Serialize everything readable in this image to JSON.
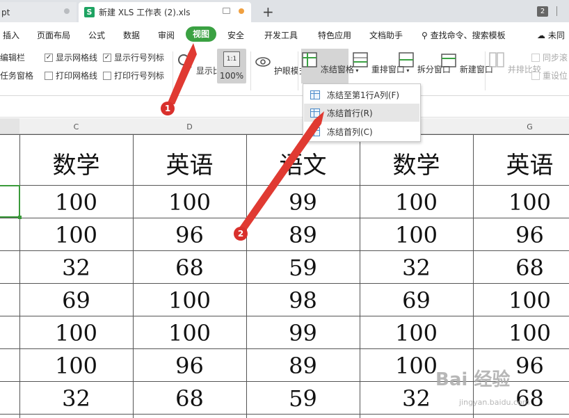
{
  "tabs": [
    {
      "label": "pt"
    },
    {
      "label": "新建 XLS 工作表 (2).xls",
      "icon": "S"
    }
  ],
  "window_badge": "2",
  "menu": [
    "插入",
    "页面布局",
    "公式",
    "数据",
    "审阅",
    "视图",
    "安全",
    "开发工具",
    "特色应用",
    "文档助手",
    "查找命令、搜索模板",
    "未同"
  ],
  "ribbon": {
    "edit_bar": "编辑栏",
    "task_pane": "任务窗格",
    "show_gridlines": "显示网格线",
    "show_row_col": "显示行号列标",
    "print_gridlines": "打印网格线",
    "print_row_col": "打印行号列标",
    "zoom": "显示比例",
    "zoom_100": "100%",
    "eye_mode": "护眼模式",
    "freeze": "冻结窗格",
    "rearrange": "重排窗口",
    "split": "拆分窗口",
    "new_window": "新建窗口",
    "side_by_side": "并排比较",
    "sync_scroll": "同步滚",
    "reset_pos": "重设位"
  },
  "dropdown": [
    "冻结至第1行A列(F)",
    "冻结首行(R)",
    "冻结首列(C)"
  ],
  "columns": [
    "C",
    "D",
    "I",
    "",
    "G"
  ],
  "table": {
    "header": [
      "数学",
      "英语",
      "语文",
      "数学",
      "英语"
    ],
    "rows": [
      [
        "100",
        "100",
        "99",
        "100",
        "100"
      ],
      [
        "100",
        "96",
        "89",
        "100",
        "96"
      ],
      [
        "32",
        "68",
        "59",
        "32",
        "68"
      ],
      [
        "69",
        "100",
        "98",
        "69",
        "100"
      ],
      [
        "100",
        "100",
        "99",
        "100",
        "100"
      ],
      [
        "100",
        "96",
        "89",
        "100",
        "96"
      ],
      [
        "32",
        "68",
        "59",
        "32",
        "68"
      ]
    ]
  },
  "annotations": [
    "1",
    "2"
  ],
  "colors": {
    "accent": "#3aa142",
    "annotation": "#d9302c"
  },
  "watermark": {
    "brand": "Bai 经验",
    "url": "jingyan.baidu.com"
  }
}
